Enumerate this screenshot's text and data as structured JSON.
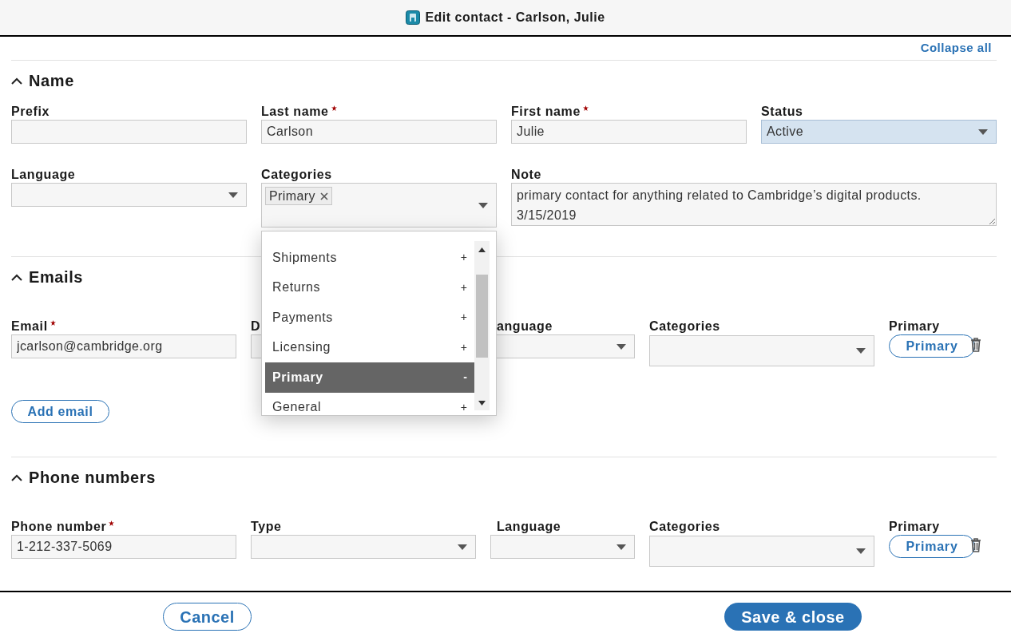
{
  "window": {
    "title": "Edit contact - Carlson, Julie"
  },
  "collapse_all": "Collapse all",
  "name_section": {
    "title": "Name",
    "expanded": true,
    "fields": [
      {
        "kind": "text",
        "label": "Prefix",
        "required": false
      },
      {
        "kind": "text",
        "label": "Last name",
        "required": true,
        "value": "Carlson"
      },
      {
        "kind": "text",
        "label": "First name",
        "required": true,
        "value": "Julie"
      },
      {
        "kind": "select",
        "label": "Status",
        "required": false,
        "value": "Active",
        "focused": true
      },
      {
        "kind": "select",
        "label": "Language",
        "required": false,
        "focused": false
      },
      {
        "kind": "multiselect",
        "label": "Categories",
        "required": false,
        "tags": [
          "Primary"
        ],
        "expanded": true,
        "options": [
          {
            "label": "Shipments",
            "action": "+",
            "selected": false
          },
          {
            "label": "Returns",
            "action": "+",
            "selected": false
          },
          {
            "label": "Payments",
            "action": "+",
            "selected": false
          },
          {
            "label": "Licensing",
            "action": "+",
            "selected": false
          },
          {
            "label": "Primary",
            "action": "-",
            "selected": true
          },
          {
            "label": "General",
            "action": "+",
            "selected": false
          }
        ]
      },
      {
        "kind": "textarea",
        "label": "Note",
        "required": false,
        "lines": [
          "primary contact for anything related to Cambridge’s digital products.",
          "3/15/2019"
        ]
      }
    ]
  },
  "emails_section": {
    "title": "Emails",
    "expanded": true,
    "columns": [
      {
        "label": "Email",
        "required": true
      },
      {
        "label": "D"
      },
      {
        "label": "anguage",
        "required": false
      },
      {
        "label": "Categories",
        "required": false
      },
      {
        "label": "Primary",
        "required": false
      }
    ],
    "rows": [
      {
        "cells": [
          {
            "kind": "text",
            "value": "jcarlson@cambridge.org"
          },
          {
            "kind": "text"
          },
          {
            "kind": "select"
          },
          {
            "kind": "multiselect"
          },
          {
            "kind": "primary",
            "label": "Primary"
          }
        ]
      }
    ],
    "add_button": "Add email"
  },
  "phones_section": {
    "title": "Phone numbers",
    "expanded": true,
    "columns": [
      {
        "label": "Phone number",
        "required": true
      },
      {
        "label": "Type",
        "required": false
      },
      {
        "label": "Language",
        "required": false
      },
      {
        "label": "Categories",
        "required": false
      },
      {
        "label": "Primary",
        "required": false
      }
    ],
    "rows": [
      {
        "cells": [
          {
            "kind": "text",
            "value": "1-212-337-5069"
          },
          {
            "kind": "select"
          },
          {
            "kind": "select"
          },
          {
            "kind": "multiselect"
          },
          {
            "kind": "primary",
            "label": "Primary"
          }
        ]
      }
    ]
  },
  "footer": {
    "cancel": "Cancel",
    "save": "Save & close"
  }
}
